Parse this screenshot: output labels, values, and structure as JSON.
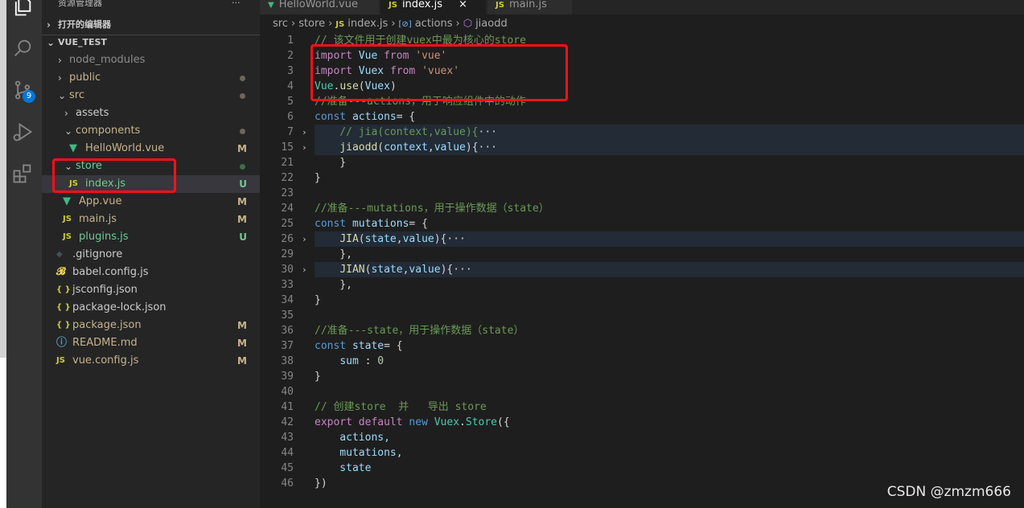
{
  "sidebar": {
    "title": "资源管理器",
    "more": "···",
    "open_editors": "打开的编辑器",
    "project": "VUE_TEST",
    "items": [
      {
        "label": "node_modules",
        "type": "folder",
        "open": false,
        "depth": 1,
        "color": "#8c8c8c"
      },
      {
        "label": "public",
        "type": "folder",
        "open": false,
        "depth": 1,
        "color": "#c6b48a",
        "status": "dot"
      },
      {
        "label": "src",
        "type": "folder",
        "open": true,
        "depth": 1,
        "color": "#c6b48a",
        "status": "dot"
      },
      {
        "label": "assets",
        "type": "folder",
        "open": false,
        "depth": 2,
        "color": "#cccccc"
      },
      {
        "label": "components",
        "type": "folder",
        "open": true,
        "depth": 2,
        "color": "#c6b48a",
        "status": "dot"
      },
      {
        "label": "HelloWorld.vue",
        "type": "vue",
        "depth": 3,
        "color": "#c6b48a",
        "status": "M"
      },
      {
        "label": "store",
        "type": "folder",
        "open": true,
        "depth": 2,
        "color": "#73c991",
        "status": "dot-green"
      },
      {
        "label": "index.js",
        "type": "js",
        "depth": 3,
        "color": "#73c991",
        "status": "U",
        "selected": true
      },
      {
        "label": "App.vue",
        "type": "vue",
        "depth": 2,
        "color": "#c6b48a",
        "status": "M"
      },
      {
        "label": "main.js",
        "type": "js",
        "depth": 2,
        "color": "#c6b48a",
        "status": "M"
      },
      {
        "label": "plugins.js",
        "type": "js",
        "depth": 2,
        "color": "#73c991",
        "status": "U"
      },
      {
        "label": ".gitignore",
        "type": "git",
        "depth": 1,
        "color": "#cccccc"
      },
      {
        "label": "babel.config.js",
        "type": "babel",
        "depth": 1,
        "color": "#cccccc"
      },
      {
        "label": "jsconfig.json",
        "type": "json",
        "depth": 1,
        "color": "#cccccc"
      },
      {
        "label": "package-lock.json",
        "type": "json",
        "depth": 1,
        "color": "#cccccc"
      },
      {
        "label": "package.json",
        "type": "json",
        "depth": 1,
        "color": "#c6b48a",
        "status": "M"
      },
      {
        "label": "README.md",
        "type": "info",
        "depth": 1,
        "color": "#c6b48a",
        "status": "M"
      },
      {
        "label": "vue.config.js",
        "type": "js",
        "depth": 1,
        "color": "#c6b48a",
        "status": "M"
      }
    ]
  },
  "activity": {
    "scm_badge": "9",
    "icons": [
      "files-icon",
      "search-icon",
      "source-control-icon",
      "run-debug-icon",
      "extensions-icon"
    ]
  },
  "tabs": [
    {
      "label": "HelloWorld.vue",
      "icon": "vue"
    },
    {
      "label": "index.js",
      "icon": "js",
      "active": true,
      "close": "×"
    },
    {
      "label": "main.js",
      "icon": "js"
    }
  ],
  "breadcrumb": [
    "src",
    "store",
    "index.js",
    "actions",
    "jiaodd"
  ],
  "code": [
    {
      "n": "1",
      "t": [
        [
          "// 该文件用于创建vuex中最为核心的store",
          "cm"
        ]
      ]
    },
    {
      "n": "2",
      "t": [
        [
          "import",
          "kw"
        ],
        [
          " Vue ",
          "var"
        ],
        [
          "from",
          "kw"
        ],
        [
          " 'vue'",
          "str"
        ]
      ]
    },
    {
      "n": "3",
      "t": [
        [
          "import",
          "kw"
        ],
        [
          " Vuex ",
          "var"
        ],
        [
          "from",
          "kw"
        ],
        [
          " 'vuex'",
          "str"
        ]
      ]
    },
    {
      "n": "4",
      "t": [
        [
          "Vue",
          "cls"
        ],
        [
          ".",
          "dim"
        ],
        [
          "use",
          "fn"
        ],
        [
          "(",
          "dim"
        ],
        [
          "Vuex",
          "var"
        ],
        [
          ")",
          "dim"
        ]
      ]
    },
    {
      "n": "5",
      "t": [
        [
          "//准备---actions，用于响应组件中的动作",
          "cm"
        ]
      ]
    },
    {
      "n": "6",
      "t": [
        [
          "const",
          "kb"
        ],
        [
          " actions",
          "var"
        ],
        [
          "= {",
          "dim"
        ]
      ]
    },
    {
      "n": "7",
      "fold": true,
      "hl": true,
      "t": [
        [
          "    // jia(context,value){",
          "cm"
        ],
        [
          "···",
          "dim"
        ]
      ]
    },
    {
      "n": "15",
      "fold": true,
      "hl": true,
      "t": [
        [
          "    ",
          "dim"
        ],
        [
          "jiaodd",
          "fn"
        ],
        [
          "(",
          "dim"
        ],
        [
          "context",
          "var"
        ],
        [
          ",",
          "dim"
        ],
        [
          "value",
          "var"
        ],
        [
          "){",
          "dim"
        ],
        [
          "···",
          "dim"
        ]
      ]
    },
    {
      "n": "21",
      "t": [
        [
          "    }",
          "dim"
        ]
      ]
    },
    {
      "n": "22",
      "t": [
        [
          "}",
          "dim"
        ]
      ]
    },
    {
      "n": "23",
      "t": []
    },
    {
      "n": "24",
      "t": [
        [
          "//准备---mutations，用于操作数据（state）",
          "cm"
        ]
      ]
    },
    {
      "n": "25",
      "t": [
        [
          "const",
          "kb"
        ],
        [
          " mutations",
          "var"
        ],
        [
          "= {",
          "dim"
        ]
      ]
    },
    {
      "n": "26",
      "fold": true,
      "hl": true,
      "t": [
        [
          "    ",
          "dim"
        ],
        [
          "JIA",
          "fn"
        ],
        [
          "(",
          "dim"
        ],
        [
          "state",
          "var"
        ],
        [
          ",",
          "dim"
        ],
        [
          "value",
          "var"
        ],
        [
          "){",
          "dim"
        ],
        [
          "···",
          "dim"
        ]
      ]
    },
    {
      "n": "29",
      "t": [
        [
          "    },",
          "dim"
        ]
      ]
    },
    {
      "n": "30",
      "fold": true,
      "hl": true,
      "t": [
        [
          "    ",
          "dim"
        ],
        [
          "JIAN",
          "fn"
        ],
        [
          "(",
          "dim"
        ],
        [
          "state",
          "var"
        ],
        [
          ",",
          "dim"
        ],
        [
          "value",
          "var"
        ],
        [
          "){",
          "dim"
        ],
        [
          "···",
          "dim"
        ]
      ]
    },
    {
      "n": "33",
      "t": [
        [
          "    },",
          "dim"
        ]
      ]
    },
    {
      "n": "34",
      "t": [
        [
          "}",
          "dim"
        ]
      ]
    },
    {
      "n": "35",
      "t": []
    },
    {
      "n": "36",
      "t": [
        [
          "//准备---state，用于操作数据（state）",
          "cm"
        ]
      ]
    },
    {
      "n": "37",
      "t": [
        [
          "const",
          "kb"
        ],
        [
          " state",
          "var"
        ],
        [
          "= {",
          "dim"
        ]
      ]
    },
    {
      "n": "38",
      "t": [
        [
          "    ",
          "dim"
        ],
        [
          "sum",
          "var"
        ],
        [
          " : ",
          "dim"
        ],
        [
          "0",
          "num"
        ]
      ]
    },
    {
      "n": "39",
      "t": [
        [
          "}",
          "dim"
        ]
      ]
    },
    {
      "n": "40",
      "t": []
    },
    {
      "n": "41",
      "t": [
        [
          "// 创建store  并   导出 store",
          "cm"
        ]
      ]
    },
    {
      "n": "42",
      "t": [
        [
          "export",
          "kw"
        ],
        [
          " ",
          "dim"
        ],
        [
          "default",
          "kw"
        ],
        [
          " new ",
          "kb"
        ],
        [
          "Vuex",
          "cls"
        ],
        [
          ".",
          "dim"
        ],
        [
          "Store",
          "cls"
        ],
        [
          "({",
          "dim"
        ]
      ]
    },
    {
      "n": "43",
      "t": [
        [
          "    actions,",
          "var"
        ]
      ]
    },
    {
      "n": "44",
      "t": [
        [
          "    mutations,",
          "var"
        ]
      ]
    },
    {
      "n": "45",
      "t": [
        [
          "    state",
          "var"
        ]
      ]
    },
    {
      "n": "46",
      "t": [
        [
          "})",
          "dim"
        ]
      ]
    }
  ],
  "watermark": "CSDN @zmzm666"
}
